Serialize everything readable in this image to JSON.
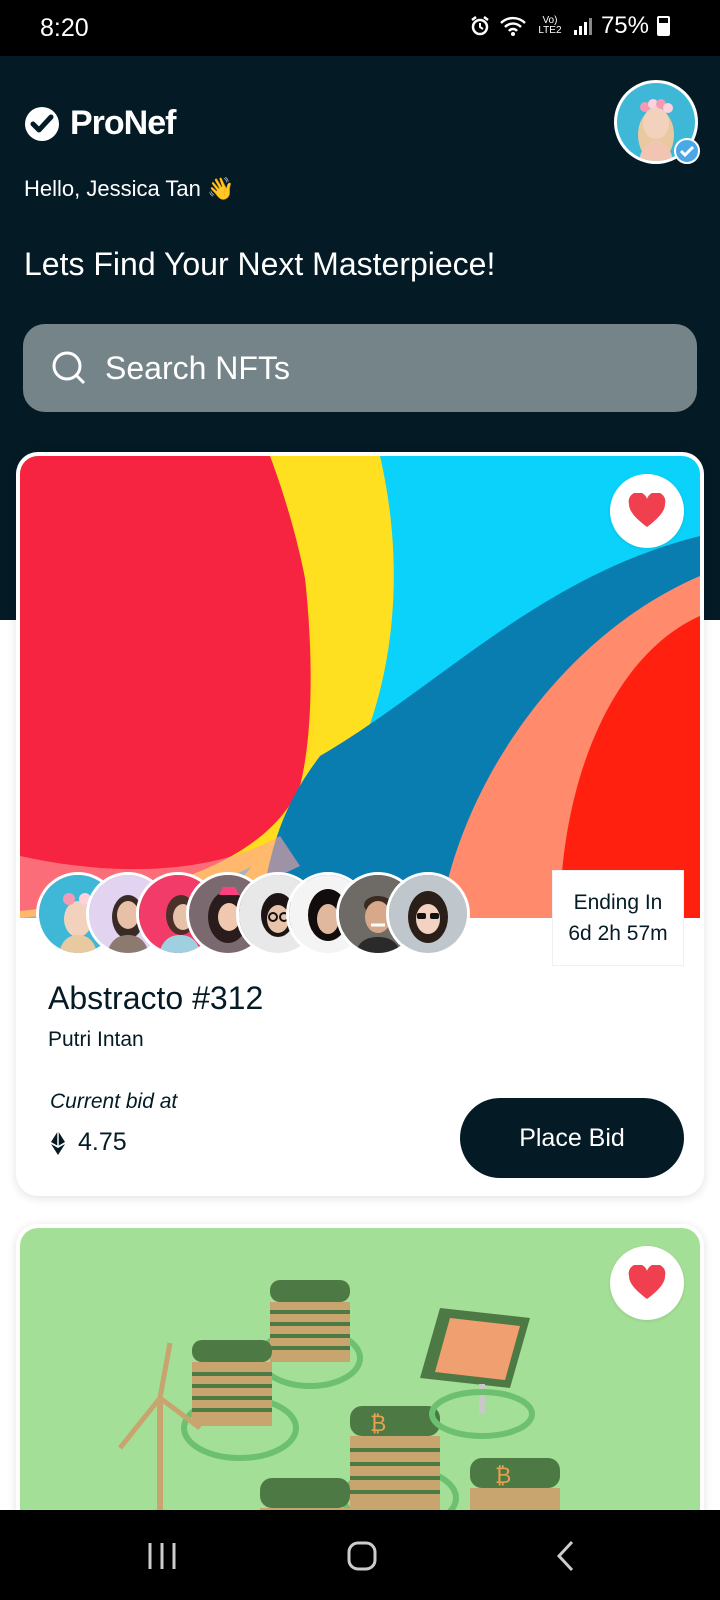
{
  "status": {
    "time": "8:20",
    "network": "Vo) LTE2",
    "battery": "75%"
  },
  "app": {
    "name": "ProNef",
    "greeting": "Hello, Jessica Tan 👋",
    "tagline": "Lets Find Your Next Masterpiece!"
  },
  "search": {
    "placeholder": "Search NFTs"
  },
  "colors": {
    "header_bg": "#041b26",
    "search_bg": "#748488",
    "heart": "#f04050",
    "card_green": "#a3df96"
  },
  "cards": [
    {
      "title": "Abstracto #312",
      "creator": "Putri Intan",
      "ending_label": "Ending In",
      "ending_time": "6d 2h 57m",
      "bid_label": "Current bid at",
      "bid_amount": "4.75",
      "button": "Place Bid",
      "favorited": true
    },
    {
      "favorited": true
    }
  ],
  "icons": [
    "check-badge-icon",
    "verified-icon",
    "search-icon",
    "heart-icon",
    "ethereum-icon",
    "recent-apps-icon",
    "home-icon",
    "back-icon"
  ]
}
